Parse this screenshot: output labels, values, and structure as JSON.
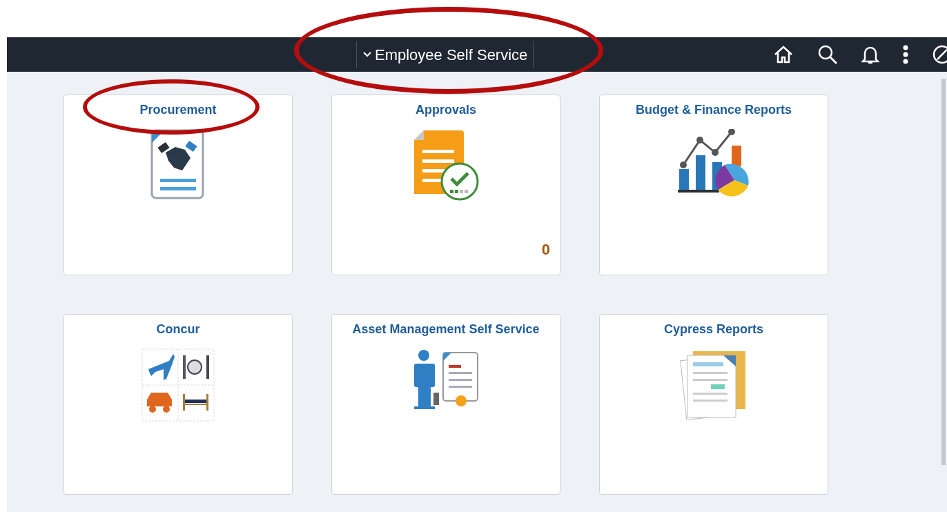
{
  "header": {
    "title": "Employee Self Service"
  },
  "tiles": [
    {
      "title": "Procurement",
      "circled": true
    },
    {
      "title": "Approvals",
      "count": "0",
      "circled": false
    },
    {
      "title": "Budget & Finance Reports",
      "circled": false
    },
    {
      "title": "Concur",
      "circled": false
    },
    {
      "title": "Asset Management Self Service",
      "circled": false
    },
    {
      "title": "Cypress Reports",
      "circled": false
    }
  ]
}
